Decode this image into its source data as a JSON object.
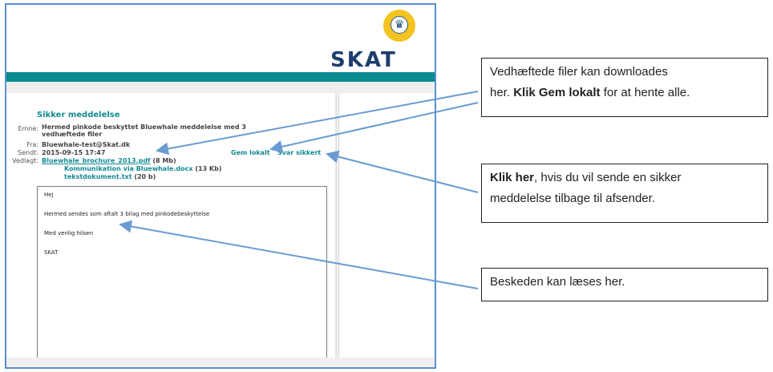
{
  "brand": {
    "name": "SKAT",
    "crown_icon": "crown-icon"
  },
  "message": {
    "heading": "Sikker meddelelse",
    "subject_label": "Emne:",
    "subject": "Hermed pinkode beskyttet Bluewhale meddelelse med 3 vedhæftede filer",
    "from_label": "Fra:",
    "from": "Bluewhale-test@Skat.dk",
    "sent_label": "Sendt:",
    "sent": "2015-09-15 17:47",
    "attach_label": "Vedlagt:",
    "attachments": [
      {
        "name": "Bluewhale_brochure_2013.pdf",
        "size": "(8 Mb)"
      },
      {
        "name": "Kommunikation via Bluewhale.docx",
        "size": "(13 Kb)"
      },
      {
        "name": "tekstdokument.txt",
        "size": "(20 b)"
      }
    ],
    "save_local": "Gem lokalt",
    "reply_secure": "Svar sikkert",
    "body": [
      "Hej",
      "Hermed sendes som aftalt 3 bilag med pinkodebeskyttelse",
      "Med venlig hilsen",
      "SKAT"
    ]
  },
  "callouts": {
    "c1_a": "Vedhæftede filer kan downloades",
    "c1_b": "her. ",
    "c1_bold": "Klik Gem lokalt",
    "c1_c": " for at hente alle.",
    "c2_bold": "Klik her",
    "c2_a": ", hvis du vil sende en sikker",
    "c2_b": "meddelelse tilbage til afsender.",
    "c3": "Beskeden kan læses her."
  },
  "colors": {
    "teal": "#0a8a8f",
    "frame": "#5b8fcf",
    "arrow": "#6a9bd1"
  }
}
